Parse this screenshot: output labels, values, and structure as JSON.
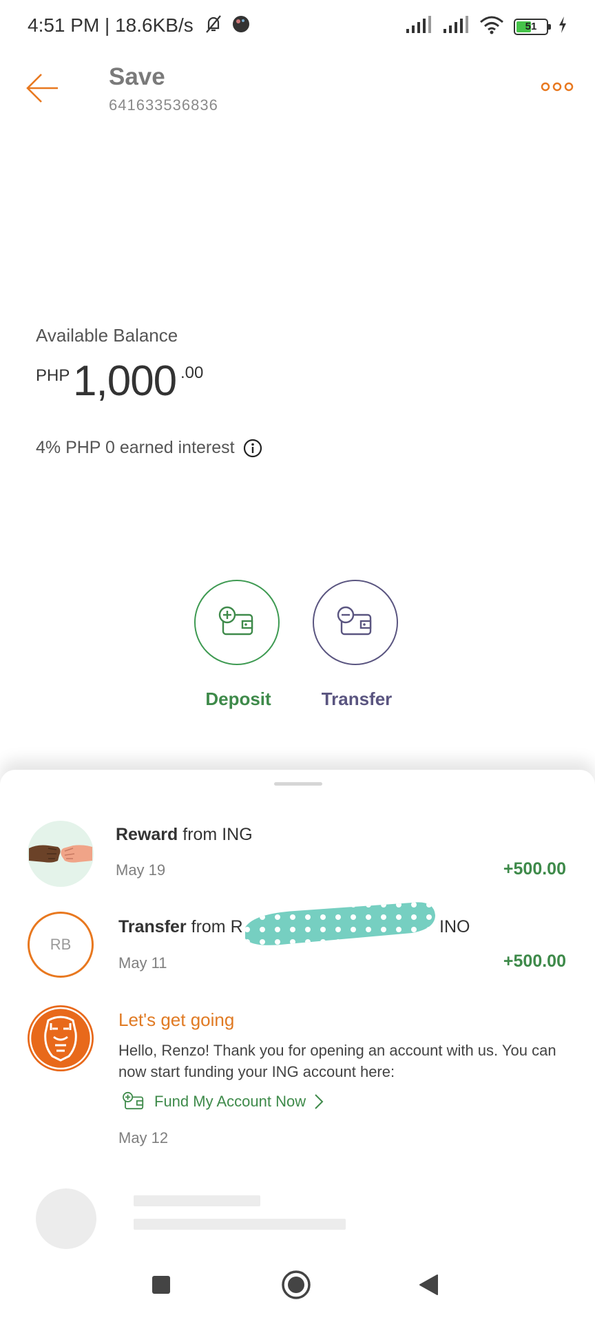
{
  "status_bar": {
    "time_text": "4:51 PM | 18.6KB/s",
    "battery": "51"
  },
  "header": {
    "title": "Save",
    "account_number": "641633536836"
  },
  "balance": {
    "label": "Available Balance",
    "currency": "PHP",
    "amount": "1,000",
    "cents": ".00",
    "interest_text": "4% PHP 0 earned interest"
  },
  "actions": {
    "deposit_label": "Deposit",
    "transfer_label": "Transfer"
  },
  "transactions": [
    {
      "title_bold": "Reward",
      "title_rest": " from ING",
      "date": "May 19",
      "amount": "+500.00"
    },
    {
      "title_bold": "Transfer",
      "title_rest": " from R",
      "title_tail": "INO",
      "avatar_initials": "RB",
      "date": "May 11",
      "amount": "+500.00"
    }
  ],
  "message": {
    "title": "Let's get going",
    "body": "Hello, Renzo! Thank you for opening an account with us. You can now start funding your ING account here:",
    "link": "Fund My Account Now",
    "date": "May 12"
  },
  "colors": {
    "accent_orange": "#e8781f",
    "green": "#3e8a4a",
    "purple": "#5a5580"
  }
}
